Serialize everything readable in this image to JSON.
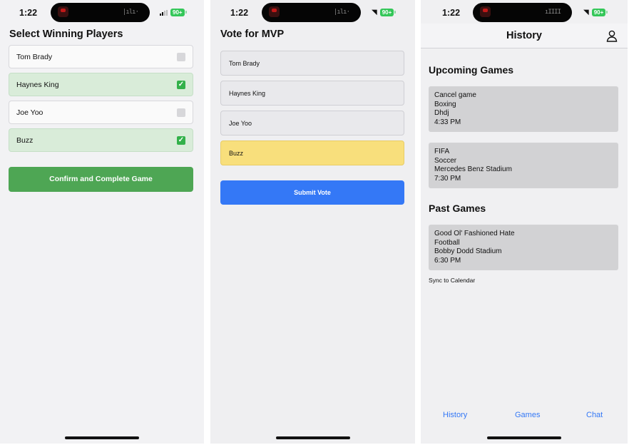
{
  "status_bar": {
    "time": "1:22",
    "battery": "90+",
    "icons": [
      "screen-recording-icon",
      "audio-wave-icon",
      "signal-icon",
      "wifi-icon",
      "battery-icon"
    ]
  },
  "screen1": {
    "title": "Select Winning Players",
    "players": [
      {
        "name": "Tom Brady",
        "selected": false
      },
      {
        "name": "Haynes King",
        "selected": true
      },
      {
        "name": "Joe Yoo",
        "selected": false
      },
      {
        "name": "Buzz",
        "selected": true
      }
    ],
    "confirm_label": "Confirm and Complete Game",
    "colors": {
      "selected_row": "#d9ecd9",
      "button": "#4ea654"
    }
  },
  "screen2": {
    "title": "Vote for MVP",
    "players": [
      {
        "name": "Tom Brady",
        "selected": false
      },
      {
        "name": "Haynes King",
        "selected": false
      },
      {
        "name": "Joe Yoo",
        "selected": false
      },
      {
        "name": "Buzz",
        "selected": true
      }
    ],
    "submit_label": "Submit Vote",
    "colors": {
      "selected_row": "#f8df7c",
      "button": "#3478f6"
    }
  },
  "screen3": {
    "title": "History",
    "upcoming_title": "Upcoming Games",
    "upcoming": [
      {
        "name": "Cancel game",
        "sport": "Boxing",
        "location": "Dhdj",
        "time": "4:33 PM"
      },
      {
        "name": "FIFA",
        "sport": "Soccer",
        "location": "Mercedes Benz Stadium",
        "time": "7:30 PM"
      }
    ],
    "past_title": "Past Games",
    "past": [
      {
        "name": "Good Ol' Fashioned Hate",
        "sport": "Football",
        "location": "Bobby Dodd Stadium",
        "time": "6:30 PM"
      }
    ],
    "sync_label": "Sync to Calendar",
    "tabs": [
      "History",
      "Games",
      "Chat"
    ],
    "colors": {
      "tab_text": "#3478f6",
      "card": "#d2d2d4"
    }
  }
}
